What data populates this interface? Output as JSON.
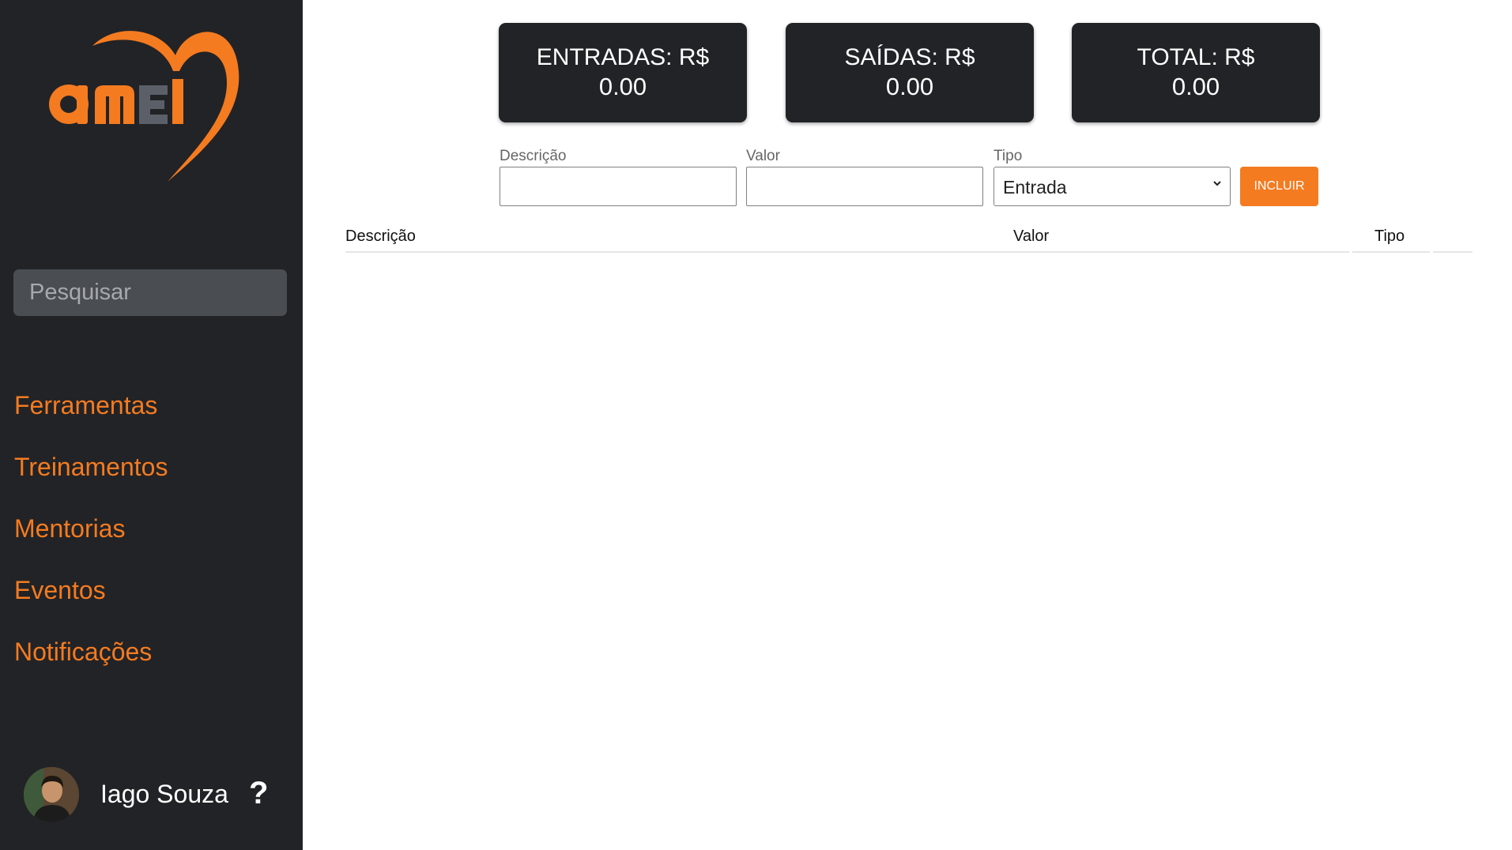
{
  "brand": {
    "logo_text": "aMEI",
    "accent_color": "#f47b20",
    "sidebar_color": "#222326"
  },
  "sidebar": {
    "search_placeholder": "Pesquisar",
    "items": [
      {
        "label": "Ferramentas"
      },
      {
        "label": "Treinamentos"
      },
      {
        "label": "Mentorias"
      },
      {
        "label": "Eventos"
      },
      {
        "label": "Notificações"
      }
    ],
    "user": {
      "name": "Iago Souza",
      "help_icon": "?"
    }
  },
  "summary": {
    "entradas": {
      "label": "ENTRADAS: R$",
      "value": "0.00"
    },
    "saidas": {
      "label": "SAÍDAS: R$",
      "value": "0.00"
    },
    "total": {
      "label": "TOTAL: R$",
      "value": "0.00"
    }
  },
  "form": {
    "descricao_label": "Descrição",
    "descricao_value": "",
    "valor_label": "Valor",
    "valor_value": "",
    "tipo_label": "Tipo",
    "tipo_selected": "Entrada",
    "submit_label": "INCLUIR"
  },
  "table": {
    "headers": [
      "Descrição",
      "Valor",
      "Tipo"
    ],
    "rows": []
  }
}
